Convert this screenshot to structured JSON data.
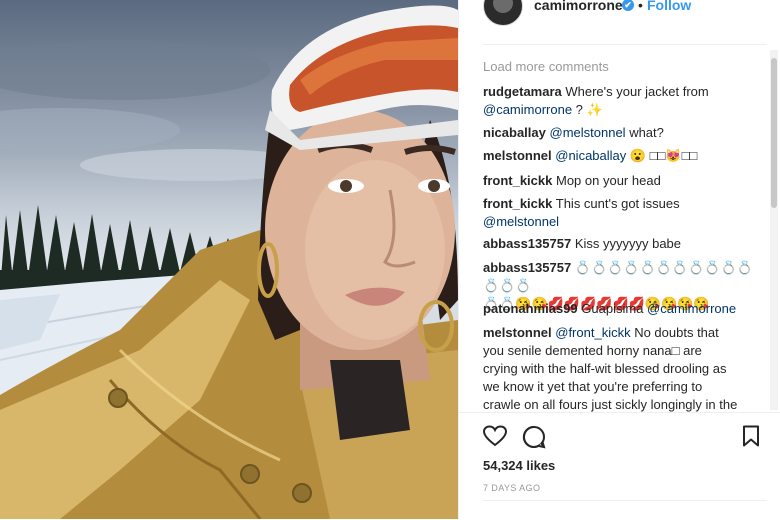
{
  "post": {
    "username": "camimorrone",
    "verified_mark": "✔",
    "separator": "•",
    "follow_label": "Follow",
    "photo_alt": "selfie"
  },
  "comments": {
    "load_more_label": "Load more comments",
    "items": [
      {
        "user": "rudgetamara",
        "text": "Where's your jacket from",
        "line2_mention": "@camimorrone",
        "line2_text": " ? ✨"
      },
      {
        "user": "nicaballay",
        "mention": "@melstonnel",
        "text": " what?"
      },
      {
        "user": "melstonnel",
        "mention": "@nicaballay",
        "text": " 😮 □□😻□□"
      },
      {
        "user": "front_kickk",
        "text": "Mop on your head"
      },
      {
        "user": "front_kickk",
        "text": "This cunt's got issues",
        "line2_mention": "@melstonnel"
      },
      {
        "user": "abbass135757",
        "text": "Kiss yyyyyyy babe"
      },
      {
        "user": "abbass135757",
        "text": "💍💍💍💍💍💍💍💍💍💍💍💍💍💍",
        "line2_text": "💍💍😘😘💋💋💋💋💋💋😘😘😘😘"
      },
      {
        "user": "patonahmias99",
        "text": "Guapisima ",
        "mention": "@camimorrone"
      },
      {
        "user": "melstonnel",
        "mention": "@front_kickk",
        "text": " No doubts that",
        "extra_lines": [
          "you senile demented horny nana□ are",
          "crying with the half-wit blessed drooling as",
          "we know it yet that you're preferring to",
          "crawle on all fours just sickly longingly in the"
        ]
      }
    ]
  },
  "actions": {
    "like_icon": "heart-icon",
    "comment_icon": "comment-icon",
    "save_icon": "bookmark-icon",
    "likes_count": "54,324 likes",
    "date": "7 DAYS AGO"
  },
  "colors": {
    "link": "#3897f0",
    "mention": "#003569",
    "muted": "#999999",
    "text": "#262626"
  }
}
